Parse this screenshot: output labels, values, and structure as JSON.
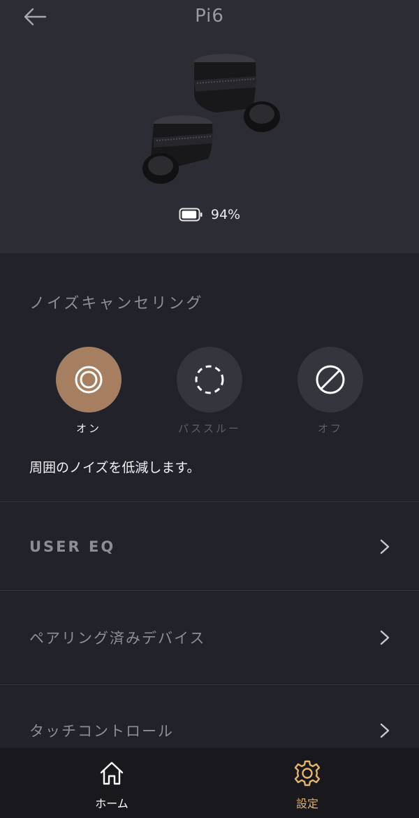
{
  "header": {
    "title": "Pi6",
    "back_icon": "arrow-left-icon"
  },
  "battery": {
    "icon": "battery-icon",
    "level_text": "94%",
    "level": 0.94
  },
  "noise_cancelling": {
    "section_label": "ノイズキャンセリング",
    "modes": [
      {
        "label": "オン",
        "icon": "anc-on-icon",
        "active": true
      },
      {
        "label": "パススルー",
        "icon": "passthrough-icon",
        "active": false
      },
      {
        "label": "オフ",
        "icon": "off-icon",
        "active": false
      }
    ],
    "description": "周囲のノイズを低減します。"
  },
  "settings_rows": [
    {
      "label": "USER EQ"
    },
    {
      "label": "ペアリング済みデバイス"
    },
    {
      "label": "タッチコントロール"
    }
  ],
  "bottom_nav": {
    "items": [
      {
        "label": "ホーム",
        "icon": "home-icon",
        "active": false
      },
      {
        "label": "設定",
        "icon": "gear-icon",
        "active": true
      }
    ]
  },
  "colors": {
    "accent": "#a67f61",
    "nav_active": "#e3b56c",
    "background": "#22222a",
    "hero_background": "#2c2c34"
  }
}
